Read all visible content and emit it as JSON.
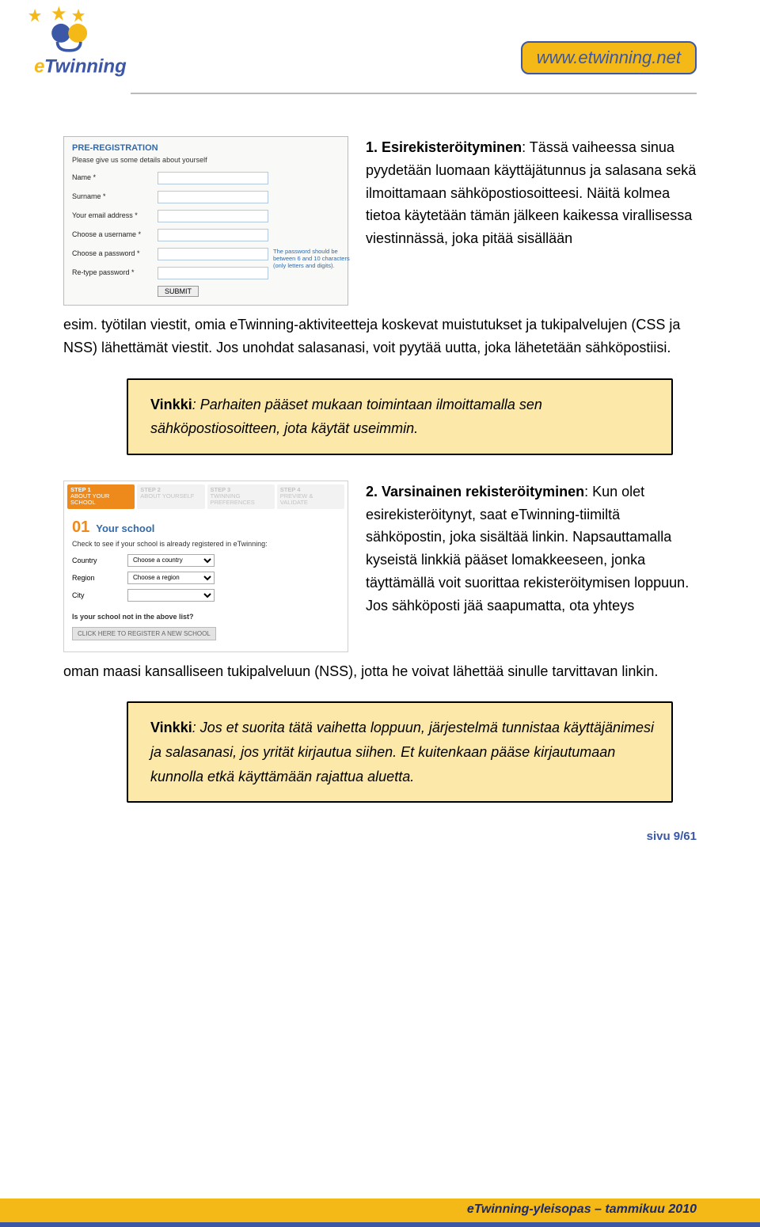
{
  "header": {
    "url_text": "www.etwinning.net",
    "logo_text": "Twinning",
    "logo_e": "e"
  },
  "prereg": {
    "title": "PRE-REGISTRATION",
    "subtitle": "Please give us some details about yourself",
    "fields": {
      "name": "Name *",
      "surname": "Surname *",
      "email": "Your email address *",
      "username": "Choose a username *",
      "password": "Choose a password *",
      "retype": "Re-type password *"
    },
    "password_hint": "The password should be between 6 and 10 characters (only letters and digits).",
    "submit": "SUBMIT"
  },
  "section1": {
    "title": "1. Esirekisteröityminen",
    "text_a": ": Tässä vaiheessa sinua pyydetään luomaan käyttäjätunnus ja salasana sekä ilmoittamaan sähköpostiosoitteesi. Näitä kolmea tietoa käytetään tämän jälkeen kaikessa virallisessa viestinnässä, joka pitää sisällään",
    "text_b": "esim. työtilan viestit, omia eTwinning-aktiviteetteja koskevat muistutukset ja tukipalvelujen (CSS ja NSS) lähettämät viestit. Jos unohdat salasanasi, voit pyytää uutta, joka lähetetään sähköpostiisi."
  },
  "tip1": {
    "label": "Vinkki",
    "text": ": Parhaiten pääset mukaan toimintaan ilmoittamalla sen sähköpostiosoitteen, jota käytät useimmin."
  },
  "school": {
    "tabs": [
      {
        "step": "STEP 1",
        "label": "ABOUT YOUR SCHOOL"
      },
      {
        "step": "STEP 2",
        "label": "ABOUT YOURSELF"
      },
      {
        "step": "STEP 3",
        "label": "TWINNING PREFERENCES"
      },
      {
        "step": "STEP 4",
        "label": "PREVIEW & VALIDATE"
      }
    ],
    "num": "01",
    "title": "Your school",
    "check_text": "Check to see if your school is already registered in eTwinning:",
    "fields": {
      "country": "Country",
      "region": "Region",
      "city": "City"
    },
    "placeholders": {
      "country": "Choose a country",
      "region": "Choose a region"
    },
    "question": "Is your school not in the above list?",
    "register_new": "CLICK HERE TO REGISTER A NEW SCHOOL"
  },
  "section2": {
    "title": "2. Varsinainen rekisteröityminen",
    "text_a": ": Kun olet esirekisteröitynyt, saat eTwinning-tiimiltä sähköpostin, joka sisältää linkin. Napsauttamalla kyseistä linkkiä pääset lomakkeeseen, jonka täyttämällä voit suorittaa rekisteröitymisen loppuun. Jos sähköposti jää saapumatta, ota yhteys",
    "text_b": "oman maasi kansalliseen tukipalveluun (NSS), jotta he voivat lähettää sinulle tarvittavan linkin."
  },
  "tip2": {
    "label": "Vinkki",
    "text": ": Jos et suorita tätä vaihetta loppuun, järjestelmä tunnistaa käyttäjänimesi ja salasanasi, jos yrität kirjautua siihen. Et kuitenkaan pääse kirjautumaan kunnolla etkä käyttämään rajattua aluetta."
  },
  "page_number": "sivu 9/61",
  "footer": "eTwinning-yleisopas – tammikuu 2010"
}
